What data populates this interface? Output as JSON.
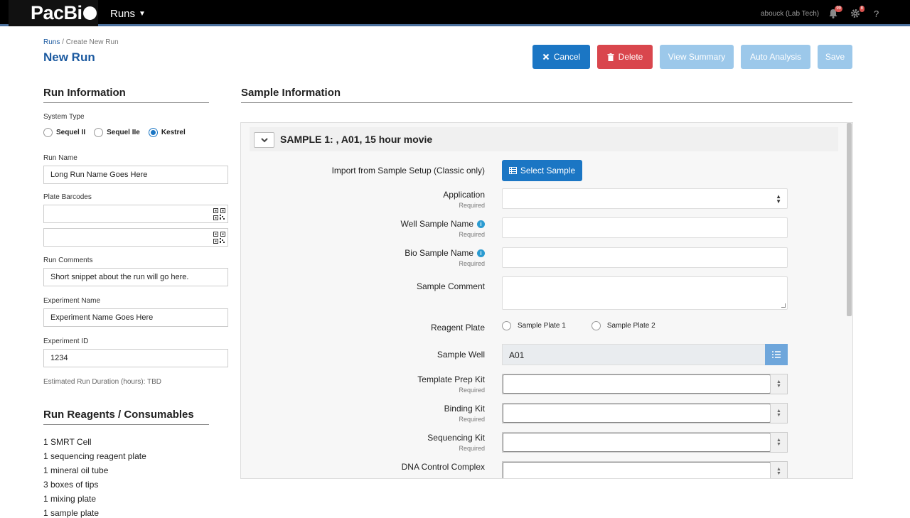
{
  "nav": {
    "logo": "PacBi",
    "runs_menu": "Runs",
    "user": "abouck (Lab Tech)",
    "notifications_count": "99",
    "settings_count": "8",
    "help": "?"
  },
  "breadcrumb": {
    "root": "Runs",
    "separator": " / ",
    "current": "Create New Run"
  },
  "page_title": "New Run",
  "actions": {
    "cancel": "Cancel",
    "delete": "Delete",
    "view_summary": "View Summary",
    "auto_analysis": "Auto Analysis",
    "save": "Save"
  },
  "run_info": {
    "title": "Run Information",
    "system_type_label": "System Type",
    "system_types": [
      "Sequel II",
      "Sequel IIe",
      "Kestrel"
    ],
    "system_type_selected": "Kestrel",
    "run_name_label": "Run Name",
    "run_name_value": "Long Run Name Goes Here",
    "plate_barcodes_label": "Plate Barcodes",
    "run_comments_label": "Run Comments",
    "run_comments_value": "Short snippet about the run will go here.",
    "experiment_name_label": "Experiment Name",
    "experiment_name_value": "Experiment Name Goes Here",
    "experiment_id_label": "Experiment ID",
    "experiment_id_value": "1234",
    "estimated_duration": "Estimated Run Duration (hours): TBD"
  },
  "reagents": {
    "title": "Run Reagents / Consumables",
    "items": [
      "1 SMRT Cell",
      "1 sequencing reagent plate",
      "1 mineral oil tube",
      "3 boxes of tips",
      "1 mixing plate",
      "1 sample plate"
    ]
  },
  "sample_info": {
    "title": "Sample Information",
    "sample_header": "SAMPLE 1: , A01, 15 hour movie",
    "import_label": "Import from Sample Setup (Classic only)",
    "select_sample": "Select Sample",
    "application_label": "Application",
    "well_sample_name_label": "Well Sample Name",
    "bio_sample_name_label": "Bio Sample Name",
    "sample_comment_label": "Sample Comment",
    "reagent_plate_label": "Reagent Plate",
    "reagent_plates": [
      "Sample Plate 1",
      "Sample Plate 2"
    ],
    "sample_well_label": "Sample Well",
    "sample_well_value": "A01",
    "template_prep_kit_label": "Template Prep Kit",
    "binding_kit_label": "Binding Kit",
    "sequencing_kit_label": "Sequencing Kit",
    "dna_control_complex_label": "DNA Control Complex",
    "required": "Required"
  }
}
